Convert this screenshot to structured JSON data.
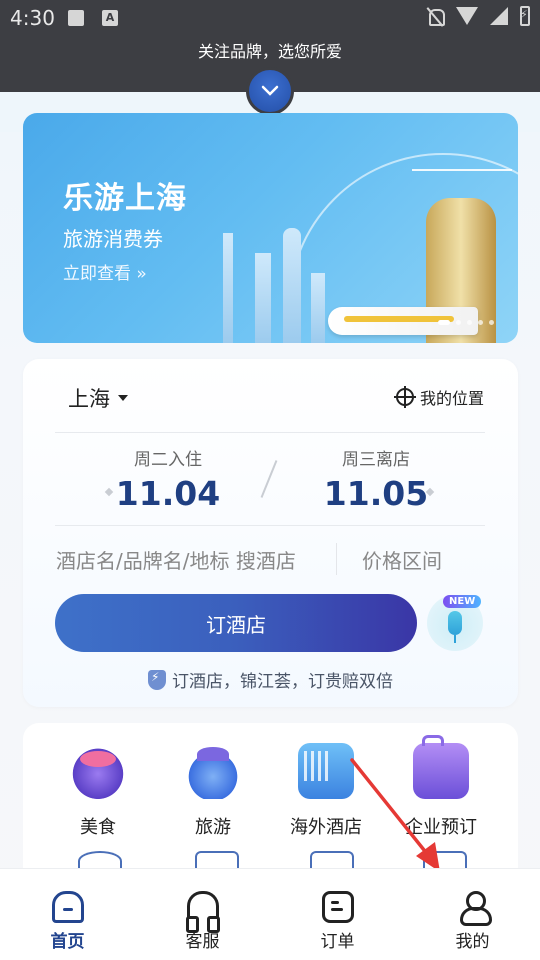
{
  "status_bar": {
    "time": "4:30",
    "icons": [
      "image-icon",
      "a-icon",
      "bell-off-icon",
      "wifi-icon",
      "signal-icon",
      "battery-icon"
    ]
  },
  "top": {
    "follow_text": "关注品牌，选您所爱",
    "expand_icon": "chevron-down-icon"
  },
  "banner": {
    "title": "乐游上海",
    "subtitle": "旅游消费券",
    "cta": "立即查看 »",
    "page_count": 5,
    "active_page": 1
  },
  "search": {
    "city": "上海",
    "my_location": "我的位置",
    "checkin_label": "周二入住",
    "checkin_date": "11.04",
    "checkout_label": "周三离店",
    "checkout_date": "11.05",
    "keyword_placeholder": "酒店名/品牌名/地标 搜酒店",
    "price_placeholder": "价格区间",
    "book_button": "订酒店",
    "voice_badge": "NEW",
    "guarantee_text": "订酒店，锦江荟，订贵赔双倍"
  },
  "services": [
    {
      "label": "美食",
      "icon": "food-icon"
    },
    {
      "label": "旅游",
      "icon": "travel-icon"
    },
    {
      "label": "海外酒店",
      "icon": "overseas-hotel-icon"
    },
    {
      "label": "企业预订",
      "icon": "luggage-icon"
    }
  ],
  "bottom_nav": [
    {
      "label": "首页",
      "icon": "home-icon",
      "active": true
    },
    {
      "label": "客服",
      "icon": "headset-icon",
      "active": false
    },
    {
      "label": "订单",
      "icon": "order-icon",
      "active": false
    },
    {
      "label": "我的",
      "icon": "user-icon",
      "active": false
    }
  ],
  "colors": {
    "primary": "#23458f",
    "button_gradient_start": "#3e71c9",
    "button_gradient_end": "#3a36a6",
    "annotation_arrow": "#e53935"
  }
}
